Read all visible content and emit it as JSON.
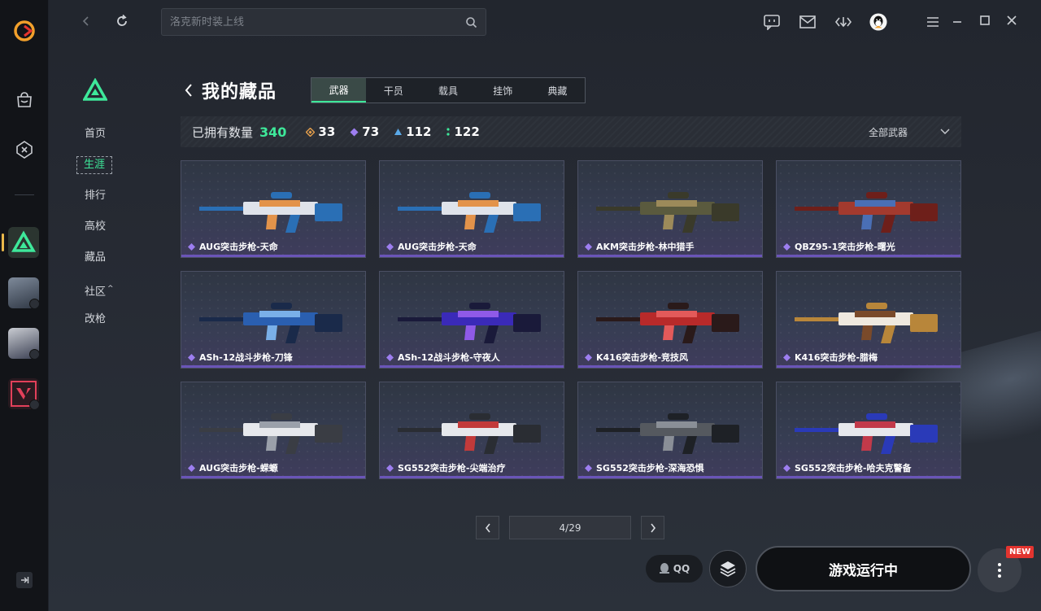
{
  "search": {
    "placeholder": "洛克新时装上线"
  },
  "subnav": {
    "items": [
      {
        "label": "首页"
      },
      {
        "label": "生涯"
      },
      {
        "label": "排行"
      },
      {
        "label": "高校"
      },
      {
        "label": "藏品"
      },
      {
        "label": "社区"
      },
      {
        "label": "改枪"
      }
    ],
    "community_caret": "^"
  },
  "page": {
    "title": "我的藏品"
  },
  "tabs": [
    {
      "label": "武器"
    },
    {
      "label": "干员"
    },
    {
      "label": "载具"
    },
    {
      "label": "挂饰"
    },
    {
      "label": "典藏"
    }
  ],
  "stats": {
    "owned_label": "已拥有数量",
    "owned_total": "340",
    "tiers": [
      {
        "icon": "orange-diamond-icon",
        "count": "33",
        "color": "#e8a14c"
      },
      {
        "icon": "purple-diamond-icon",
        "count": "73",
        "color": "#9d7ef0"
      },
      {
        "icon": "blue-triangle-icon",
        "count": "112",
        "color": "#5aa9e8"
      },
      {
        "icon": "green-dots-icon",
        "count": "122",
        "color": "#3ee89a"
      }
    ],
    "filter_label": "全部武器"
  },
  "items": [
    {
      "name": "AUG突击步枪-天命",
      "palette": [
        "#dfe3ea",
        "#2a6fb5",
        "#e3934a"
      ]
    },
    {
      "name": "AUG突击步枪-天命",
      "palette": [
        "#dfe3ea",
        "#2a6fb5",
        "#e3934a"
      ]
    },
    {
      "name": "AKM突击步枪-林中猎手",
      "palette": [
        "#5a5a3e",
        "#3a3a2a",
        "#9c8a5a"
      ]
    },
    {
      "name": "QBZ95-1突击步枪-曙光",
      "palette": [
        "#a33a2e",
        "#6e1f1a",
        "#4a6fb5"
      ]
    },
    {
      "name": "ASh-12战斗步枪-刀锋",
      "palette": [
        "#2a5fb0",
        "#1a2a4a",
        "#7ab0e8"
      ]
    },
    {
      "name": "ASh-12战斗步枪-守夜人",
      "palette": [
        "#3a2ab8",
        "#1a1a3a",
        "#8f5ae8"
      ]
    },
    {
      "name": "K416突击步枪-竞技风",
      "palette": [
        "#b82a2a",
        "#2a1a1a",
        "#e35a5a"
      ]
    },
    {
      "name": "K416突击步枪-腊梅",
      "palette": [
        "#efe9df",
        "#b8863a",
        "#7a4a2a"
      ]
    },
    {
      "name": "AUG突击步枪-蝾螈",
      "palette": [
        "#e6e8ec",
        "#3a3d44",
        "#9aa0aa"
      ]
    },
    {
      "name": "SG552突击步枪-尖端治疗",
      "palette": [
        "#e6e8ec",
        "#2a2d33",
        "#c23a3a"
      ]
    },
    {
      "name": "SG552突击步枪-深海恐惧",
      "palette": [
        "#55595f",
        "#1e2126",
        "#8a8f97"
      ]
    },
    {
      "name": "SG552突击步枪-哈夫克警备",
      "palette": [
        "#e6e8ec",
        "#2a3ab8",
        "#c23a4a"
      ]
    }
  ],
  "pager": {
    "text": "4/29",
    "prev": "‹",
    "next": "›"
  },
  "actions": {
    "qq_label": "QQ",
    "launch_label": "游戏运行中",
    "new_badge": "NEW"
  },
  "colors": {
    "accent": "#3ee89a",
    "rarity_purple": "#9d7ef0"
  }
}
